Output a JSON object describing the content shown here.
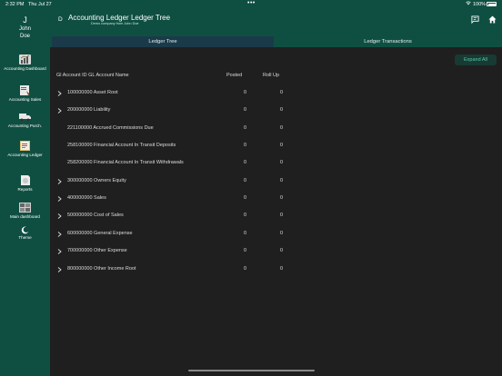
{
  "status_bar": {
    "time": "2:32 PM",
    "date": "Thu Jul 27",
    "dots": "•••",
    "battery": "100%"
  },
  "sidebar": {
    "user_initial": "J",
    "user_first": "John",
    "user_last": "Doe",
    "items": [
      {
        "label": "Accounting Dashboard",
        "icon": "dashboard-icon"
      },
      {
        "label": "Accounting Sales",
        "icon": "sales-icon"
      },
      {
        "label": "Accounting Purch.",
        "icon": "purchase-truck-icon"
      },
      {
        "label": "Accounting Ledger",
        "icon": "ledger-icon"
      },
      {
        "label": "Reports",
        "icon": "reports-icon"
      },
      {
        "label": "Main dashboard",
        "icon": "main-dashboard-icon"
      },
      {
        "label": "Theme",
        "icon": "theme-moon-icon"
      }
    ]
  },
  "header": {
    "back_letter": "D",
    "title": "Accounting Ledger  Ledger Tree",
    "subtitle": "Demo company from John Doe"
  },
  "tabs": [
    {
      "label": "Ledger Tree",
      "active": true
    },
    {
      "label": "Ledger Transactions",
      "active": false
    }
  ],
  "main": {
    "expand_all_label": "Expand All",
    "columns": {
      "id_name": "Gl Account ID  GL Account Name",
      "posted": "Posted",
      "rollup": "Roll Up"
    },
    "rows": [
      {
        "name": "100000000 Asset Root",
        "posted": "0",
        "rollup": "0",
        "expandable": true
      },
      {
        "name": "200000000 Liability",
        "posted": "0",
        "rollup": "0",
        "expandable": true
      },
      {
        "name": "221100000 Accrued Commissions Due",
        "posted": "0",
        "rollup": "0",
        "expandable": false
      },
      {
        "name": "258100000 Financial Account In Transit Deposits",
        "posted": "0",
        "rollup": "0",
        "expandable": false
      },
      {
        "name": "258200000 Financial Account In Transit Withdrawals",
        "posted": "0",
        "rollup": "0",
        "expandable": false
      },
      {
        "name": "300000000 Owners Equity",
        "posted": "0",
        "rollup": "0",
        "expandable": true
      },
      {
        "name": "400000000 Sales",
        "posted": "0",
        "rollup": "0",
        "expandable": true
      },
      {
        "name": "500000000 Cost of Sales",
        "posted": "0",
        "rollup": "0",
        "expandable": true
      },
      {
        "name": "600000000 General Expense",
        "posted": "0",
        "rollup": "0",
        "expandable": true
      },
      {
        "name": "700000000 Other Expense",
        "posted": "0",
        "rollup": "0",
        "expandable": true
      },
      {
        "name": "800000000 Other Income Root",
        "posted": "0",
        "rollup": "0",
        "expandable": true
      }
    ]
  },
  "colors": {
    "brand": "#0f4f42",
    "accent": "#56c8a8",
    "background": "#1f1f1f",
    "active_tab": "#1a3a4a"
  }
}
